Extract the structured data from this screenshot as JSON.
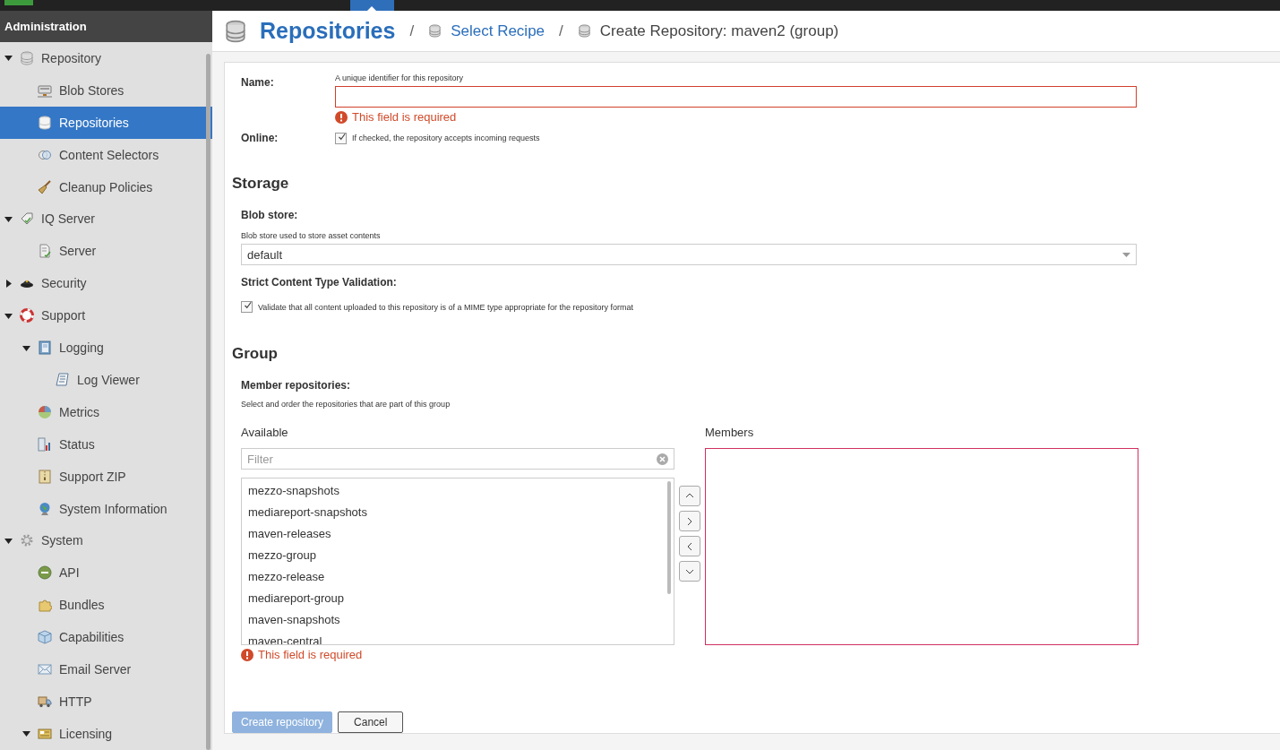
{
  "sidebar": {
    "title": "Administration",
    "items": [
      {
        "label": "Repository",
        "expanded": true,
        "selected": false,
        "children": [
          {
            "label": "Blob Stores",
            "selected": false
          },
          {
            "label": "Repositories",
            "selected": true
          },
          {
            "label": "Content Selectors",
            "selected": false
          },
          {
            "label": "Cleanup Policies",
            "selected": false
          }
        ]
      },
      {
        "label": "IQ Server",
        "expanded": true,
        "selected": false,
        "children": [
          {
            "label": "Server",
            "selected": false
          }
        ]
      },
      {
        "label": "Security",
        "expanded": false,
        "selected": false
      },
      {
        "label": "Support",
        "expanded": true,
        "selected": false,
        "children": [
          {
            "label": "Logging",
            "expanded": true,
            "selected": false,
            "children": [
              {
                "label": "Log Viewer",
                "selected": false
              }
            ]
          },
          {
            "label": "Metrics",
            "selected": false
          },
          {
            "label": "Status",
            "selected": false
          },
          {
            "label": "Support ZIP",
            "selected": false
          },
          {
            "label": "System Information",
            "selected": false
          }
        ]
      },
      {
        "label": "System",
        "expanded": true,
        "selected": false,
        "children": [
          {
            "label": "API",
            "selected": false
          },
          {
            "label": "Bundles",
            "selected": false
          },
          {
            "label": "Capabilities",
            "selected": false
          },
          {
            "label": "Email Server",
            "selected": false
          },
          {
            "label": "HTTP",
            "selected": false
          },
          {
            "label": "Licensing",
            "expanded": true,
            "selected": false
          }
        ]
      }
    ]
  },
  "breadcrumb": {
    "title": "Repositories",
    "separator_1": "/",
    "link": "Select Recipe",
    "separator_2": "/",
    "current": "Create Repository: maven2 (group)"
  },
  "form": {
    "name": {
      "label": "Name:",
      "hint": "A unique identifier for this repository",
      "error": "This field is required"
    },
    "online": {
      "label": "Online:",
      "checked": true,
      "text": "If checked, the repository accepts incoming requests"
    },
    "storage": {
      "heading": "Storage",
      "blob_label": "Blob store:",
      "blob_hint": "Blob store used to store asset contents",
      "blob_value": "default",
      "strict_label": "Strict Content Type Validation:",
      "strict_checked": true,
      "strict_text": "Validate that all content uploaded to this repository is of a MIME type appropriate for the repository format"
    },
    "group": {
      "heading": "Group",
      "members_label": "Member repositories:",
      "members_hint": "Select and order the repositories that are part of this group",
      "available_label": "Available",
      "members_title": "Members",
      "filter": {
        "placeholder": "Filter"
      },
      "available": [
        "mezzo-snapshots",
        "mediareport-snapshots",
        "maven-releases",
        "mezzo-group",
        "mezzo-release",
        "mediareport-group",
        "maven-snapshots",
        "maven-central"
      ],
      "error": "This field is required"
    },
    "buttons": [
      {
        "label": "Create repository",
        "kind": "primary",
        "disabled": true
      },
      {
        "label": "Cancel",
        "kind": "secondary",
        "disabled": false
      }
    ]
  }
}
